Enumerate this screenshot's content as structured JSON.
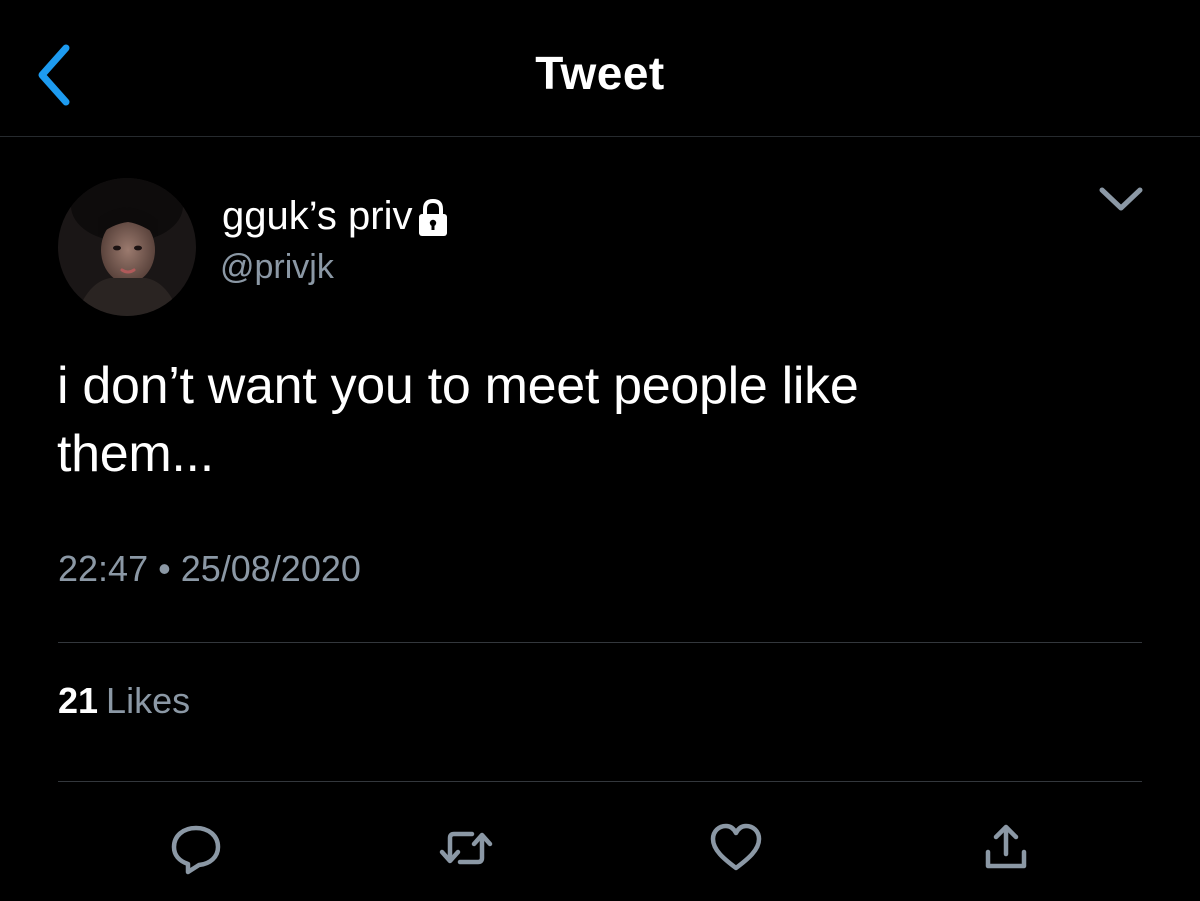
{
  "header": {
    "title": "Tweet",
    "back_icon": "chevron-left-icon"
  },
  "tweet": {
    "author": {
      "display_name": "gguk’s priv",
      "handle": "@privjk",
      "protected_icon": "lock-icon"
    },
    "text_line1": "i don’t want you to meet people like",
    "text_line2": "them...",
    "time": "22:47",
    "separator": "•",
    "date": "25/08/2020",
    "likes_count": "21",
    "likes_label": "Likes"
  },
  "actions": [
    "reply-icon",
    "retweet-icon",
    "like-icon",
    "share-icon"
  ],
  "colors": {
    "background": "#000000",
    "accent": "#1d9bf0",
    "text_primary": "#ffffff",
    "text_secondary": "#8b98a5",
    "divider": "#33373c"
  }
}
